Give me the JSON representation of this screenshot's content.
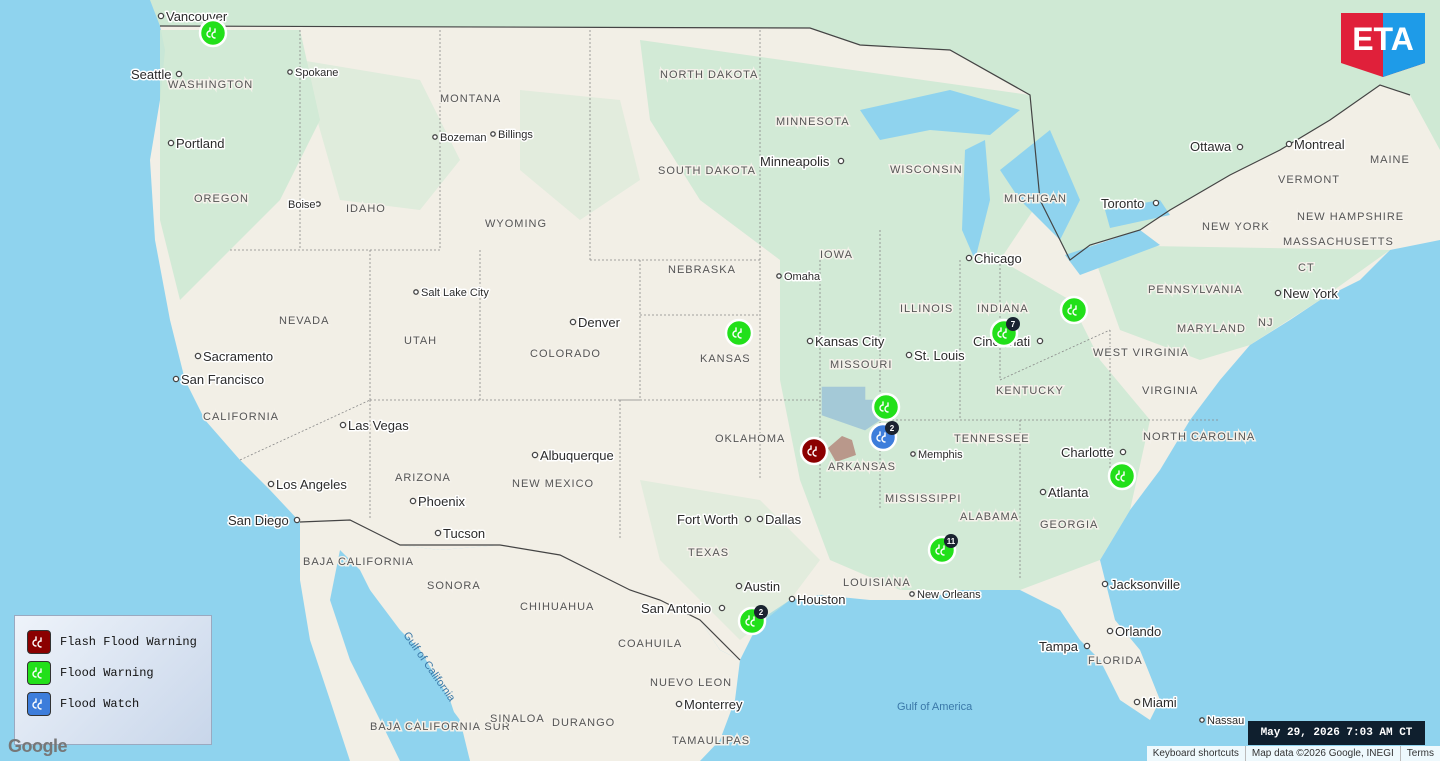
{
  "map": {
    "countries": [
      "BAJA CALIFORNIA",
      "SONORA",
      "CHIHUAHUA",
      "COAHUILA",
      "NUEVO LEON",
      "BAJA CALIFORNIA SUR",
      "SINALOA",
      "DURANGO",
      "TAMAULIPAS"
    ],
    "states": [
      "WASHINGTON",
      "OREGON",
      "IDAHO",
      "MONTANA",
      "WYOMING",
      "NEVADA",
      "UTAH",
      "COLORADO",
      "CALIFORNIA",
      "ARIZONA",
      "NEW MEXICO",
      "NORTH DAKOTA",
      "SOUTH DAKOTA",
      "NEBRASKA",
      "KANSAS",
      "OKLAHOMA",
      "TEXAS",
      "MINNESOTA",
      "IOWA",
      "MISSOURI",
      "ARKANSAS",
      "LOUISIANA",
      "WISCONSIN",
      "ILLINOIS",
      "MISSISSIPPI",
      "MICHIGAN",
      "INDIANA",
      "KENTUCKY",
      "TENNESSEE",
      "ALABAMA",
      "GEORGIA",
      "FLORIDA",
      "WEST VIRGINIA",
      "VIRGINIA",
      "NORTH CAROLINA",
      "PENNSYLVANIA",
      "NEW YORK",
      "MARYLAND",
      "NJ",
      "CT",
      "MASSACHUSETTS",
      "VERMONT",
      "NEW HAMPSHIRE",
      "MAINE"
    ],
    "cities": [
      "Vancouver",
      "Seattle",
      "Spokane",
      "Portland",
      "Boise",
      "Bozeman",
      "Billings",
      "Salt Lake City",
      "Denver",
      "Sacramento",
      "San Francisco",
      "Las Vegas",
      "Los Angeles",
      "San Diego",
      "Phoenix",
      "Tucson",
      "Albuquerque",
      "Omaha",
      "Kansas City",
      "St. Louis",
      "Minneapolis",
      "Chicago",
      "Cincinnati",
      "Memphis",
      "Fort Worth",
      "Dallas",
      "Austin",
      "San Antonio",
      "Houston",
      "New Orleans",
      "Atlanta",
      "Charlotte",
      "Jacksonville",
      "Orlando",
      "Tampa",
      "Miami",
      "Nassau",
      "Monterrey",
      "Toronto",
      "Ottawa",
      "Montreal",
      "New York"
    ],
    "water": [
      "Gulf of California",
      "Gulf of America"
    ]
  },
  "markers": [
    {
      "type": "flood_warning",
      "count": ""
    },
    {
      "type": "flood_warning",
      "count": ""
    },
    {
      "type": "flood_warning",
      "count": "7"
    },
    {
      "type": "flood_warning",
      "count": ""
    },
    {
      "type": "flood_warning",
      "count": ""
    },
    {
      "type": "flood_watch",
      "count": "2"
    },
    {
      "type": "flash_flood_warning",
      "count": ""
    },
    {
      "type": "flood_warning",
      "count": ""
    },
    {
      "type": "flood_warning",
      "count": "11"
    },
    {
      "type": "flood_warning",
      "count": "2"
    }
  ],
  "legend": {
    "items": [
      {
        "label": "Flash Flood Warning",
        "color": "#8b0000"
      },
      {
        "label": "Flood Warning",
        "color": "#22e01a"
      },
      {
        "label": "Flood Watch",
        "color": "#3d7ddb"
      }
    ]
  },
  "logo": {
    "text": "ETA",
    "red": "#e0203a",
    "blue": "#1e9be8"
  },
  "timestamp": "May 29, 2026 7:03 AM CT",
  "attribution": {
    "shortcuts": "Keyboard shortcuts",
    "mapdata": "Map data ©2026 Google, INEGI",
    "terms": "Terms"
  },
  "google_logo": "Google"
}
